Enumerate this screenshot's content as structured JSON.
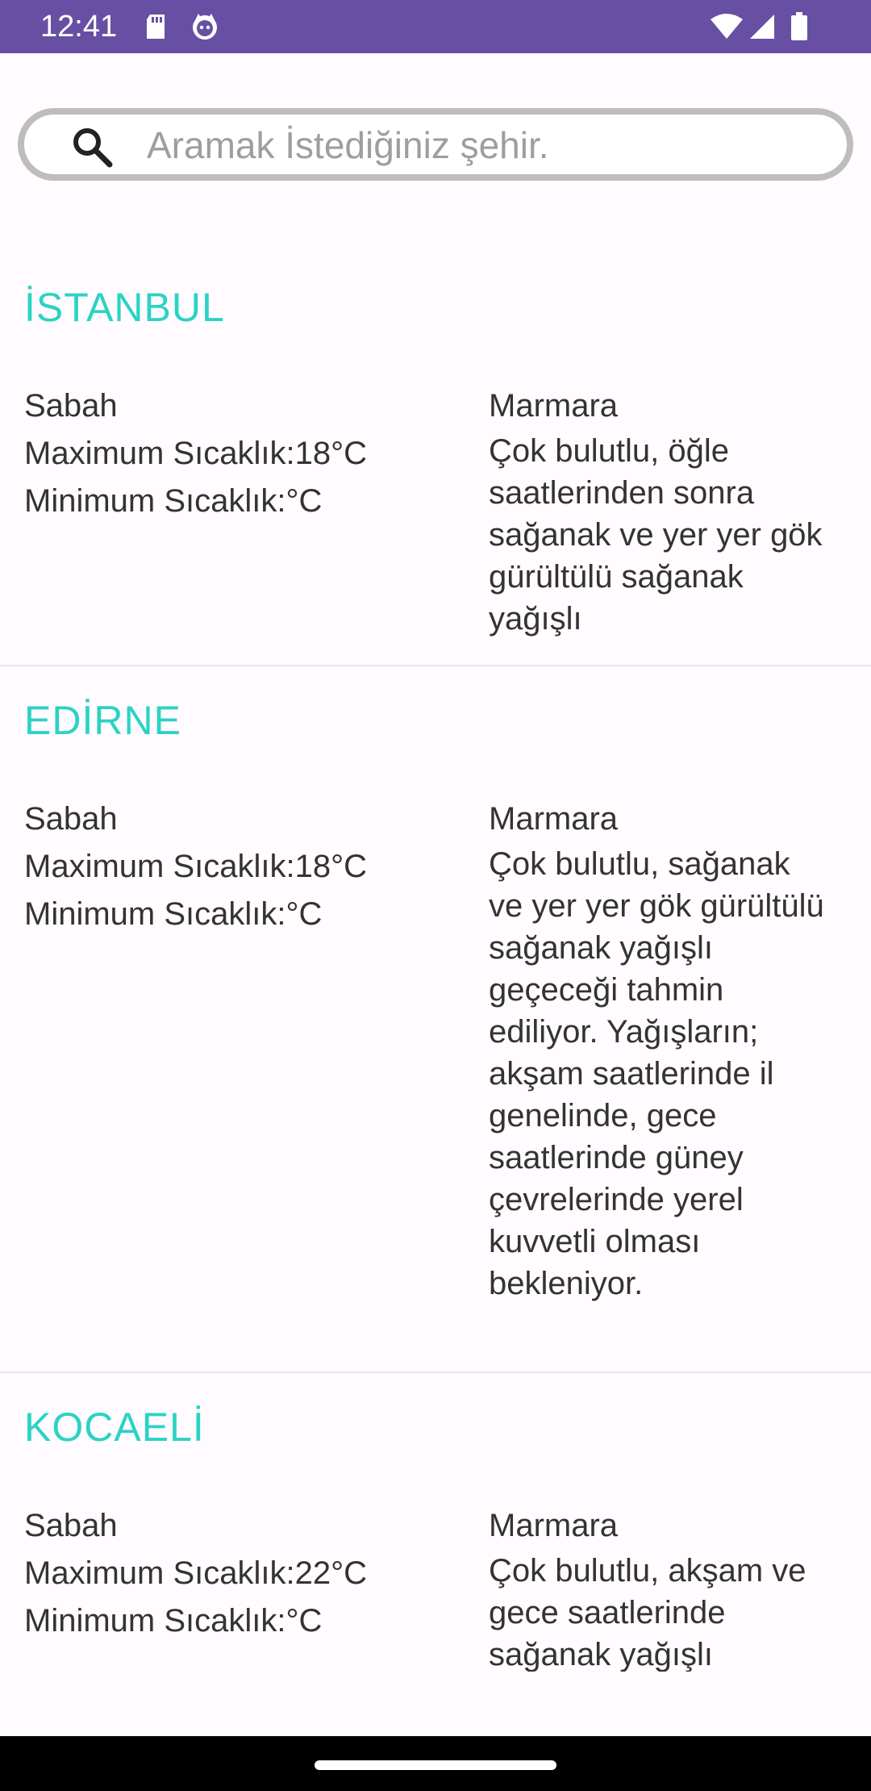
{
  "status_bar": {
    "time": "12:41",
    "icons": [
      "sd-card-icon",
      "cat-icon",
      "wifi-icon",
      "signal-icon",
      "battery-icon"
    ],
    "background": "#6750a4"
  },
  "search": {
    "placeholder": "Aramak İstediğiniz şehir.",
    "value": "",
    "icon": "search-icon"
  },
  "accent_color": "#2ad3c4",
  "cities": [
    {
      "name": "İSTANBUL",
      "period": "Sabah",
      "max_temp": "Maximum Sıcaklık:18°C",
      "min_temp": "Minimum Sıcaklık:°C",
      "region": "Marmara",
      "description": "Çok bulutlu, öğle saatlerinden sonra sağanak ve yer yer gök gürültülü sağanak yağışlı"
    },
    {
      "name": "EDİRNE",
      "period": "Sabah",
      "max_temp": "Maximum Sıcaklık:18°C",
      "min_temp": "Minimum Sıcaklık:°C",
      "region": "Marmara",
      "description": "Çok bulutlu, sağanak ve yer yer gök gürültülü sağanak yağışlı geçeceği tahmin ediliyor. Yağışların; akşam saatlerinde il genelinde, gece saatlerinde güney çevrelerinde yerel kuvvetli olması bekleniyor."
    },
    {
      "name": "KOCAELİ",
      "period": "Sabah",
      "max_temp": "Maximum Sıcaklık:22°C",
      "min_temp": "Minimum Sıcaklık:°C",
      "region": "Marmara",
      "description": "Çok bulutlu, akşam ve gece saatlerinde sağanak yağışlı"
    }
  ]
}
